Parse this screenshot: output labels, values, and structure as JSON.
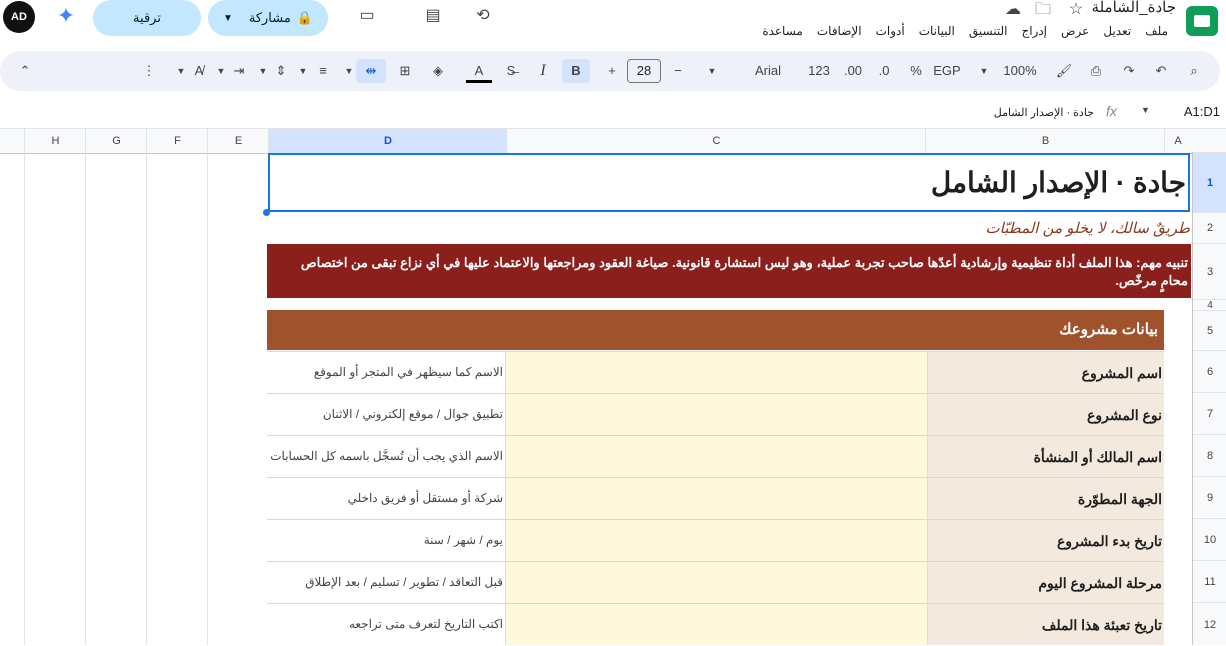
{
  "doc": {
    "title": "جادة_الشاملة"
  },
  "menu": [
    "ملف",
    "تعديل",
    "عرض",
    "إدراج",
    "التنسيق",
    "البيانات",
    "أدوات",
    "الإضافات",
    "مساعدة"
  ],
  "header": {
    "share_label": "مشاركة",
    "upgrade_label": "ترقية",
    "avatar_text": "AD"
  },
  "toolbar": {
    "zoom": "100%",
    "currency": "EGP",
    "percent": "%",
    "dec_less": ".0",
    "dec_more": ".00",
    "number_format": "123",
    "font": "Arial",
    "font_size": "28",
    "bold": "B",
    "italic": "I"
  },
  "formula_bar": {
    "cell_ref": "A1:D1",
    "fx": "fx",
    "content": "جادة  ·  الإصدار الشامل"
  },
  "columns": [
    "A",
    "B",
    "C",
    "D",
    "E",
    "F",
    "G",
    "H"
  ],
  "rows": [
    "1",
    "2",
    "3",
    "4",
    "5",
    "6",
    "7",
    "8",
    "9",
    "10",
    "11",
    "12"
  ],
  "sheet": {
    "title": "جادة   ·   الإصدار الشامل",
    "tagline": "طريقٌ سالك، لا يخلو من المطبّات",
    "warning": "تنبيه مهم:  هذا الملف أداة تنظيمية وإرشادية أعدّها صاحب تجربة عملية،  وهو ليس استشارة قانونية. صياغة العقود ومراجعتها والاعتماد عليها في أي نزاع تبقى من اختصاص محامٍ مرخّص.",
    "section_title": "بيانات مشروعك",
    "fields": [
      {
        "label": "اسم المشروع",
        "hint": "الاسم كما سيظهر في المتجر أو الموقع"
      },
      {
        "label": "نوع المشروع",
        "hint": "تطبيق جوال / موقع إلكتروني / الاثنان"
      },
      {
        "label": "اسم المالك أو المنشأة",
        "hint": "الاسم الذي يجب أن تُسجَّل باسمه كل الحسابات"
      },
      {
        "label": "الجهة المطوّرة",
        "hint": "شركة أو مستقل أو فريق داخلي"
      },
      {
        "label": "تاريخ بدء المشروع",
        "hint": "يوم / شهر / سنة"
      },
      {
        "label": "مرحلة المشروع اليوم",
        "hint": "قبل التعاقد / تطوير / تسليم / بعد الإطلاق"
      },
      {
        "label": "تاريخ تعبئة هذا الملف",
        "hint": "اكتب التاريخ لتعرف متى تراجعه"
      }
    ]
  }
}
